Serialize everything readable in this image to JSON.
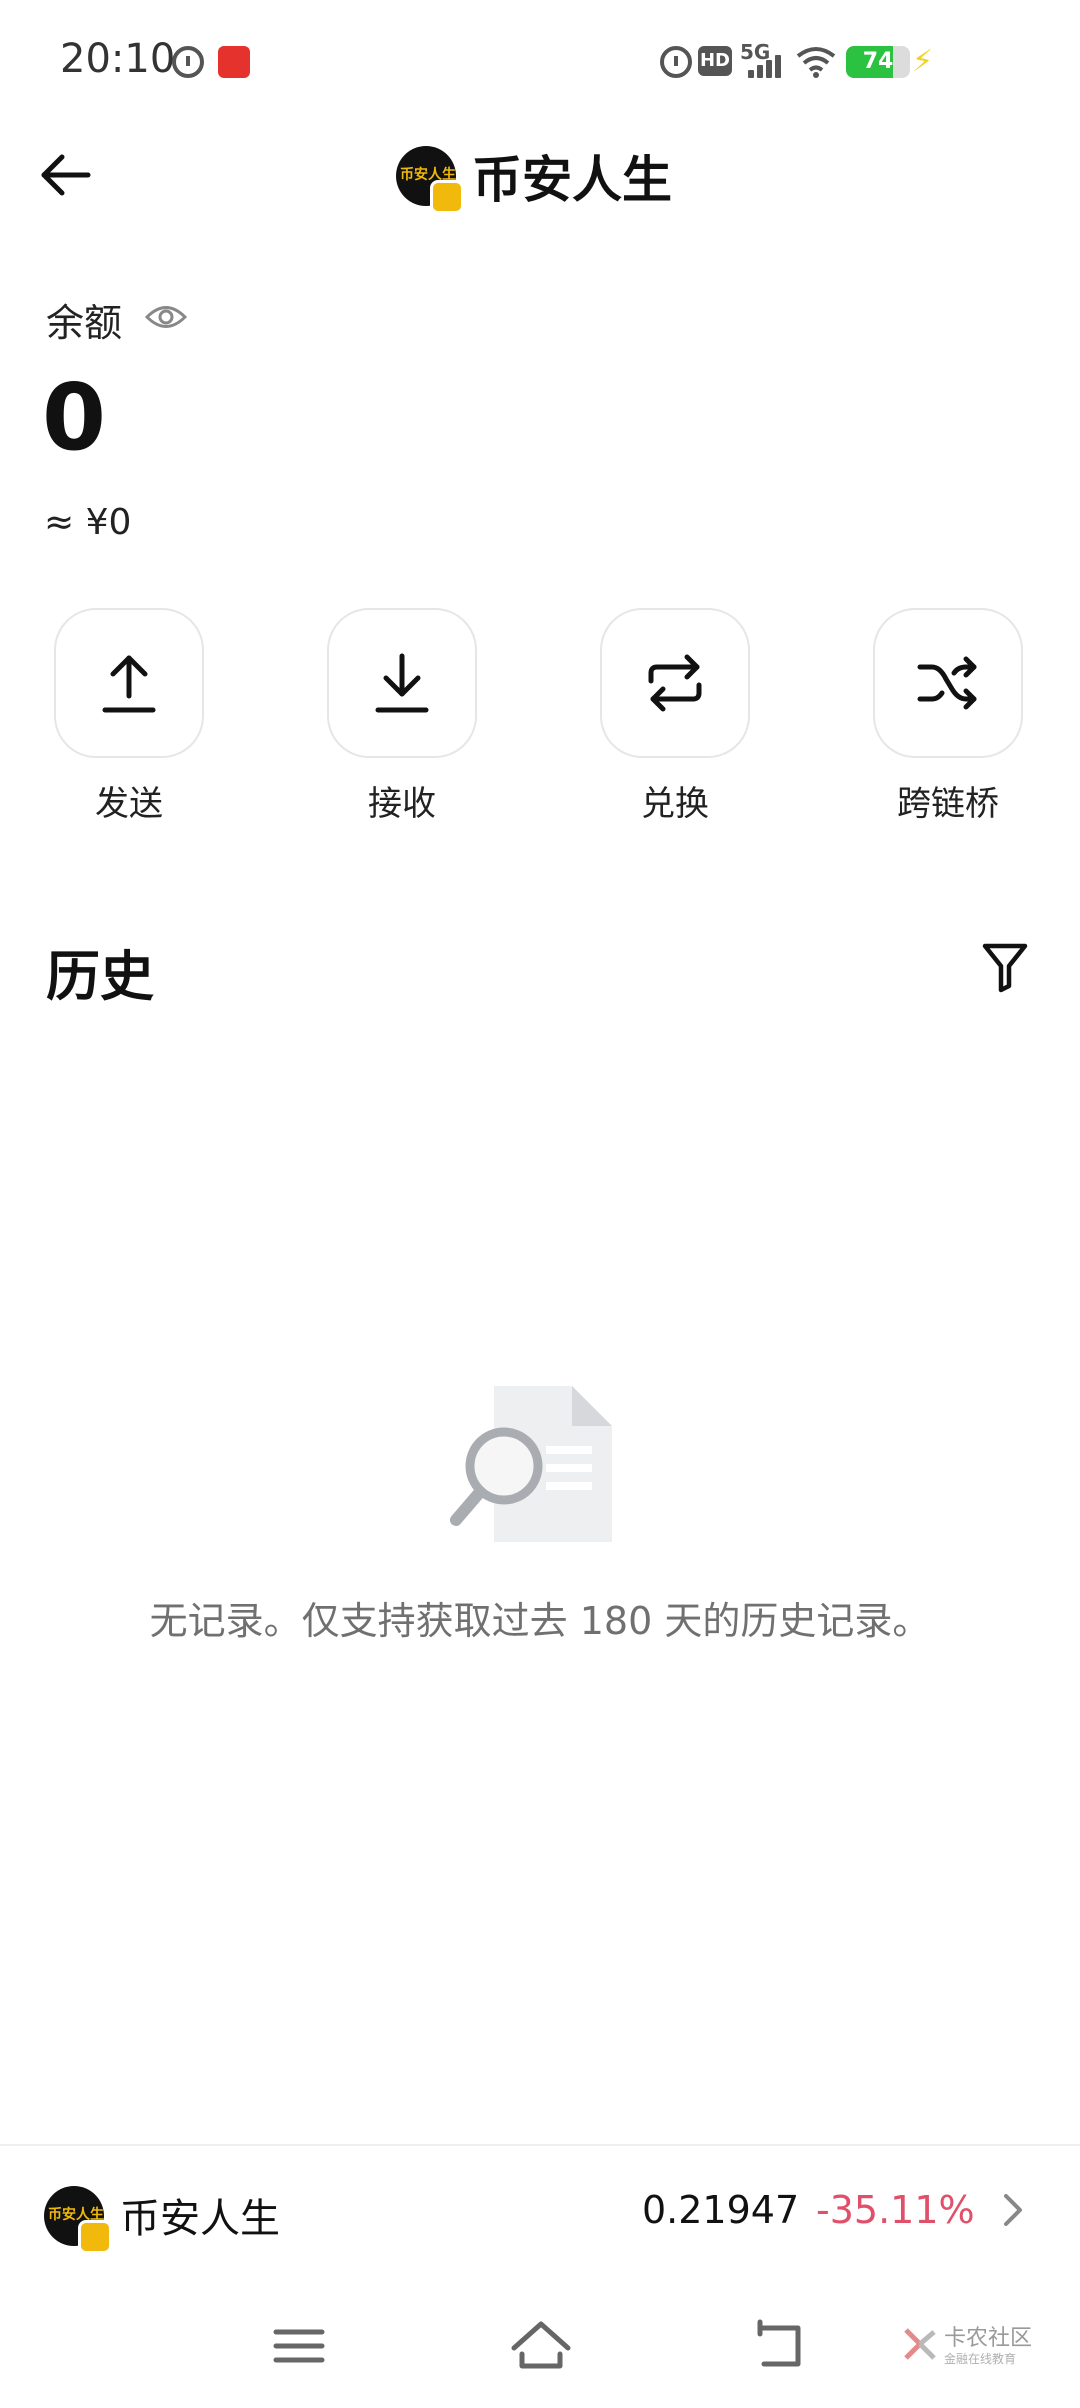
{
  "status_bar": {
    "time": "20:10",
    "battery": "74",
    "network": "5G",
    "hd": "HD"
  },
  "header": {
    "title": "币安人生",
    "avatar_text": "币安人生"
  },
  "balance": {
    "label": "余额",
    "amount": "0",
    "fiat": "≈ ¥0"
  },
  "actions": [
    {
      "label": "发送",
      "icon": "upload-arrow-icon"
    },
    {
      "label": "接收",
      "icon": "download-arrow-icon"
    },
    {
      "label": "兑换",
      "icon": "swap-icon"
    },
    {
      "label": "跨链桥",
      "icon": "shuffle-icon"
    }
  ],
  "history": {
    "title": "历史",
    "empty_message": "无记录。仅支持获取过去 180 天的历史记录。"
  },
  "ticker": {
    "name": "币安人生",
    "price": "0.21947",
    "change": "-35.11%"
  },
  "watermark": {
    "text": "卡农社区",
    "sub": "金融在线教育"
  },
  "colors": {
    "brand_yellow": "#f0b90b",
    "negative": "#e0506a",
    "text_primary": "#111111",
    "text_secondary": "#707070"
  }
}
